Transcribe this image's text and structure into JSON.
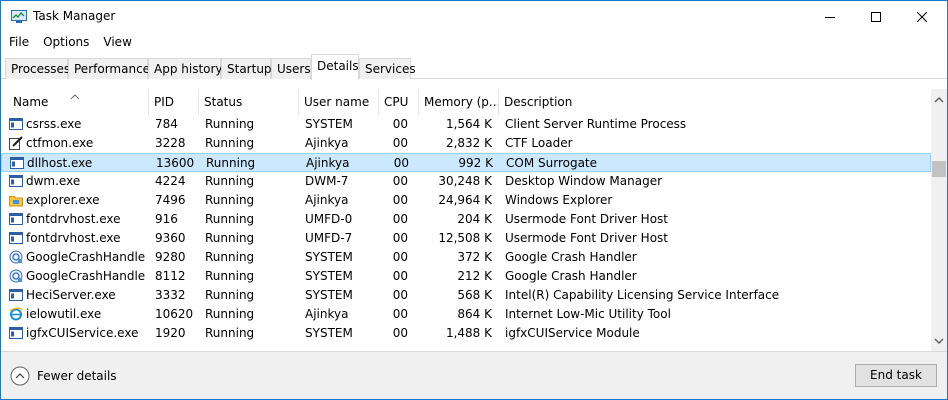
{
  "window": {
    "title": "Task Manager",
    "app_icon": "task-manager-icon",
    "controls": [
      "minimize-icon",
      "maximize-icon",
      "close-icon"
    ]
  },
  "menu": [
    "File",
    "Options",
    "View"
  ],
  "tabs": [
    {
      "label": "Processes",
      "active": false
    },
    {
      "label": "Performance",
      "active": false
    },
    {
      "label": "App history",
      "active": false
    },
    {
      "label": "Startup",
      "active": false
    },
    {
      "label": "Users",
      "active": false
    },
    {
      "label": "Details",
      "active": true
    },
    {
      "label": "Services",
      "active": false
    }
  ],
  "columns": [
    "Name",
    "PID",
    "Status",
    "User name",
    "CPU",
    "Memory (p...",
    "Description"
  ],
  "sort_indicator": "chevron-up-icon",
  "rows": [
    {
      "icon": "window-app-icon",
      "name": "csrss.exe",
      "pid": "784",
      "status": "Running",
      "user": "SYSTEM",
      "cpu": "00",
      "memory": "1,564 K",
      "description": "Client Server Runtime Process",
      "selected": false
    },
    {
      "icon": "pen-icon",
      "name": "ctfmon.exe",
      "pid": "3228",
      "status": "Running",
      "user": "Ajinkya",
      "cpu": "00",
      "memory": "2,832 K",
      "description": "CTF Loader",
      "selected": false
    },
    {
      "icon": "window-app-icon",
      "name": "dllhost.exe",
      "pid": "13600",
      "status": "Running",
      "user": "Ajinkya",
      "cpu": "00",
      "memory": "992 K",
      "description": "COM Surrogate",
      "selected": true
    },
    {
      "icon": "window-app-icon",
      "name": "dwm.exe",
      "pid": "4224",
      "status": "Running",
      "user": "DWM-7",
      "cpu": "00",
      "memory": "30,248 K",
      "description": "Desktop Window Manager",
      "selected": false
    },
    {
      "icon": "folder-icon",
      "name": "explorer.exe",
      "pid": "7496",
      "status": "Running",
      "user": "Ajinkya",
      "cpu": "00",
      "memory": "24,964 K",
      "description": "Windows Explorer",
      "selected": false
    },
    {
      "icon": "window-app-icon",
      "name": "fontdrvhost.exe",
      "pid": "916",
      "status": "Running",
      "user": "UMFD-0",
      "cpu": "00",
      "memory": "204 K",
      "description": "Usermode Font Driver Host",
      "selected": false
    },
    {
      "icon": "window-app-icon",
      "name": "fontdrvhost.exe",
      "pid": "9360",
      "status": "Running",
      "user": "UMFD-7",
      "cpu": "00",
      "memory": "12,508 K",
      "description": "Usermode Font Driver Host",
      "selected": false
    },
    {
      "icon": "google-crash-icon",
      "name": "GoogleCrashHandler...",
      "pid": "9280",
      "status": "Running",
      "user": "SYSTEM",
      "cpu": "00",
      "memory": "372 K",
      "description": "Google Crash Handler",
      "selected": false
    },
    {
      "icon": "google-crash-icon",
      "name": "GoogleCrashHandler...",
      "pid": "8112",
      "status": "Running",
      "user": "SYSTEM",
      "cpu": "00",
      "memory": "212 K",
      "description": "Google Crash Handler",
      "selected": false
    },
    {
      "icon": "window-app-icon",
      "name": "HeciServer.exe",
      "pid": "3332",
      "status": "Running",
      "user": "SYSTEM",
      "cpu": "00",
      "memory": "568 K",
      "description": "Intel(R) Capability Licensing Service Interface",
      "selected": false
    },
    {
      "icon": "internet-explorer-icon",
      "name": "ielowutil.exe",
      "pid": "10620",
      "status": "Running",
      "user": "Ajinkya",
      "cpu": "00",
      "memory": "864 K",
      "description": "Internet Low-Mic Utility Tool",
      "selected": false
    },
    {
      "icon": "window-app-icon",
      "name": "igfxCUIService.exe",
      "pid": "1920",
      "status": "Running",
      "user": "SYSTEM",
      "cpu": "00",
      "memory": "1,488 K",
      "description": "igfxCUIService Module",
      "selected": false
    }
  ],
  "footer": {
    "fewer_details": "Fewer details",
    "fewer_icon": "chevron-up-circle-icon",
    "end_task": "End task"
  },
  "colors": {
    "selection_fill": "#cce8ff",
    "selection_border": "#99d1ff",
    "window_border": "#1979ca",
    "footer_bg": "#f0f0f0"
  }
}
